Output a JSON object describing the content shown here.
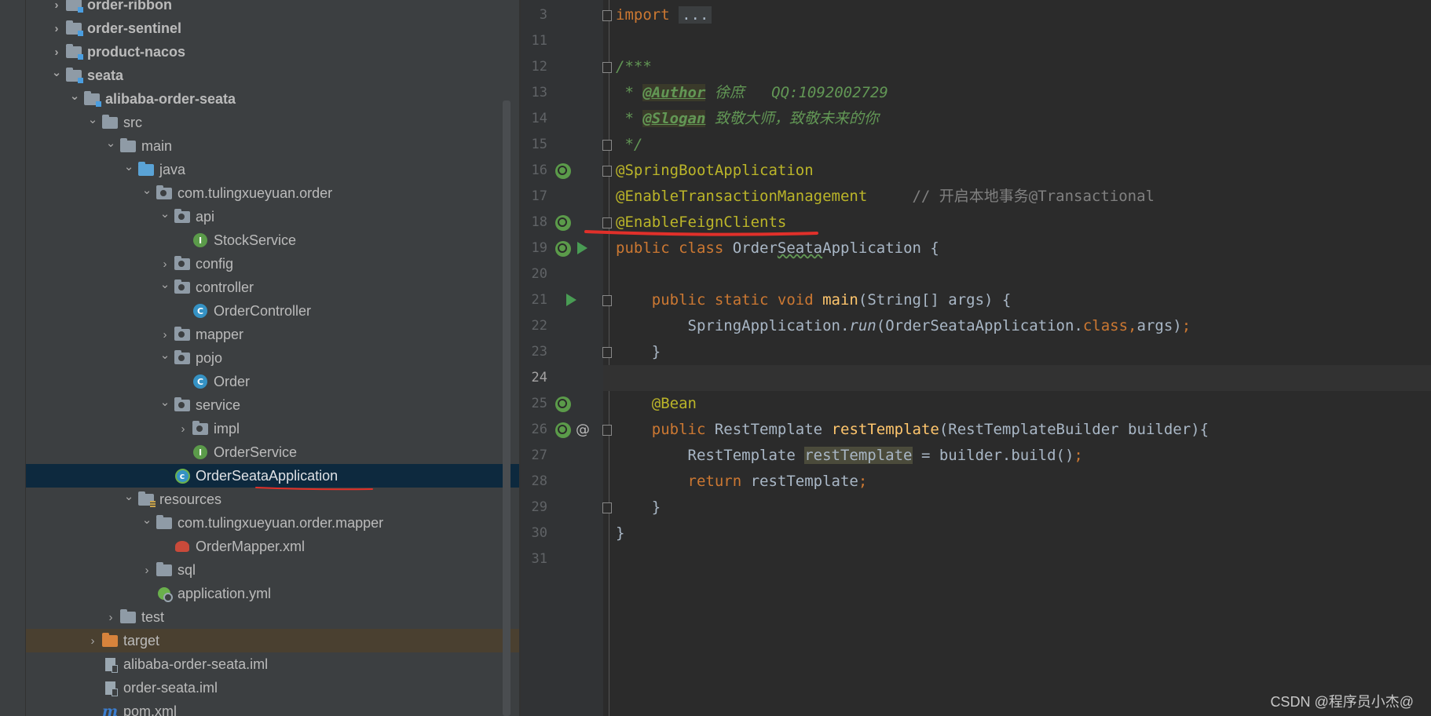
{
  "project_tree": [
    {
      "label": "order-ribbon",
      "indent": 0,
      "arrow": "right",
      "icon": "module",
      "bold": true
    },
    {
      "label": "order-sentinel",
      "indent": 0,
      "arrow": "right",
      "icon": "module",
      "bold": true
    },
    {
      "label": "product-nacos",
      "indent": 0,
      "arrow": "right",
      "icon": "module",
      "bold": true
    },
    {
      "label": "seata",
      "indent": 0,
      "arrow": "down",
      "icon": "module",
      "bold": true
    },
    {
      "label": "alibaba-order-seata",
      "indent": 1,
      "arrow": "down",
      "icon": "module",
      "bold": true
    },
    {
      "label": "src",
      "indent": 2,
      "arrow": "down",
      "icon": "folder"
    },
    {
      "label": "main",
      "indent": 3,
      "arrow": "down",
      "icon": "folder"
    },
    {
      "label": "java",
      "indent": 4,
      "arrow": "down",
      "icon": "folder-blue"
    },
    {
      "label": "com.tulingxueyuan.order",
      "indent": 5,
      "arrow": "down",
      "icon": "package"
    },
    {
      "label": "api",
      "indent": 6,
      "arrow": "down",
      "icon": "package"
    },
    {
      "label": "StockService",
      "indent": 7,
      "arrow": "none",
      "icon": "interface"
    },
    {
      "label": "config",
      "indent": 6,
      "arrow": "right",
      "icon": "package"
    },
    {
      "label": "controller",
      "indent": 6,
      "arrow": "down",
      "icon": "package"
    },
    {
      "label": "OrderController",
      "indent": 7,
      "arrow": "none",
      "icon": "class"
    },
    {
      "label": "mapper",
      "indent": 6,
      "arrow": "right",
      "icon": "package"
    },
    {
      "label": "pojo",
      "indent": 6,
      "arrow": "down",
      "icon": "package"
    },
    {
      "label": "Order",
      "indent": 7,
      "arrow": "none",
      "icon": "class"
    },
    {
      "label": "service",
      "indent": 6,
      "arrow": "down",
      "icon": "package"
    },
    {
      "label": "impl",
      "indent": 7,
      "arrow": "right",
      "icon": "package"
    },
    {
      "label": "OrderService",
      "indent": 7,
      "arrow": "none",
      "icon": "interface"
    },
    {
      "label": "OrderSeataApplication",
      "indent": 6,
      "arrow": "none",
      "icon": "boot-class",
      "selected": true
    },
    {
      "label": "resources",
      "indent": 4,
      "arrow": "down",
      "icon": "resources"
    },
    {
      "label": "com.tulingxueyuan.order.mapper",
      "indent": 5,
      "arrow": "down",
      "icon": "folder"
    },
    {
      "label": "OrderMapper.xml",
      "indent": 6,
      "arrow": "none",
      "icon": "xml"
    },
    {
      "label": "sql",
      "indent": 5,
      "arrow": "right",
      "icon": "folder"
    },
    {
      "label": "application.yml",
      "indent": 5,
      "arrow": "none",
      "icon": "yml"
    },
    {
      "label": "test",
      "indent": 3,
      "arrow": "right",
      "icon": "folder"
    },
    {
      "label": "target",
      "indent": 2,
      "arrow": "right",
      "icon": "folder-orange",
      "target": true
    },
    {
      "label": "alibaba-order-seata.iml",
      "indent": 2,
      "arrow": "none",
      "icon": "iml"
    },
    {
      "label": "order-seata.iml",
      "indent": 2,
      "arrow": "none",
      "icon": "iml"
    },
    {
      "label": "pom.xml",
      "indent": 2,
      "arrow": "none",
      "icon": "maven"
    }
  ],
  "icons": {
    "right": "›",
    "down": "⌄",
    "maven_glyph": "m",
    "interface_glyph": "I",
    "class_glyph": "C",
    "boot_glyph": "c"
  },
  "editor": {
    "lines": [
      {
        "n": "3"
      },
      {
        "n": "11"
      },
      {
        "n": "12"
      },
      {
        "n": "13"
      },
      {
        "n": "14"
      },
      {
        "n": "15"
      },
      {
        "n": "16"
      },
      {
        "n": "17"
      },
      {
        "n": "18"
      },
      {
        "n": "19"
      },
      {
        "n": "20"
      },
      {
        "n": "21"
      },
      {
        "n": "22"
      },
      {
        "n": "23"
      },
      {
        "n": "24"
      },
      {
        "n": "25"
      },
      {
        "n": "26"
      },
      {
        "n": "27"
      },
      {
        "n": "28"
      },
      {
        "n": "29"
      },
      {
        "n": "30"
      },
      {
        "n": "31"
      }
    ],
    "current_line": "24",
    "tokens": {
      "import_kw": "import ",
      "import_fold": "...",
      "doc_open": "/***",
      "doc_star": " * ",
      "author_tag": "@Author",
      "author_val": " 徐庶   QQ:1092002729",
      "slogan_tag": "@Slogan",
      "slogan_val": " 致敬大师，致敬未来的你",
      "doc_close": " */",
      "ann_boot": "@SpringBootApplication",
      "ann_tx": "@EnableTransactionManagement",
      "tx_comment": "     // 开启本地事务@Transactional",
      "ann_feign": "@EnableFeignClients",
      "public_class": "public class ",
      "class_name_a": "Order",
      "class_name_b": "Seata",
      "class_name_c": "Application {",
      "main_mods": "    public static void ",
      "main_name": "main",
      "main_args": "(String[] args) {",
      "run_indent": "        SpringApplication.",
      "run_name": "run",
      "run_args": "(OrderSeataApplication.",
      "run_class": "class,",
      "run_end": "args)",
      "semi": ";",
      "close_inner": "    }",
      "bean_ann": "    @Bean",
      "rt_mods": "    public ",
      "rt_type": "RestTemplate ",
      "rt_name": "restTemplate",
      "rt_params": "(RestTemplateBuilder builder){",
      "rt_local_indent": "        RestTemplate ",
      "rt_local": "restTemplate",
      "rt_build": " = builder.build()",
      "ret_indent": "        ",
      "ret_kw": "return ",
      "ret_val": "restTemplate",
      "close_outer": "}",
      "at_sign": "@"
    }
  },
  "colors": {
    "keyword": "#cc7832",
    "annotation": "#bbb529",
    "doc": "#629755",
    "method": "#ffc66d",
    "plain": "#a9b7c6",
    "selection": "#0d293e",
    "red_mark": "#e0302a"
  },
  "watermark": "CSDN @程序员小杰@"
}
